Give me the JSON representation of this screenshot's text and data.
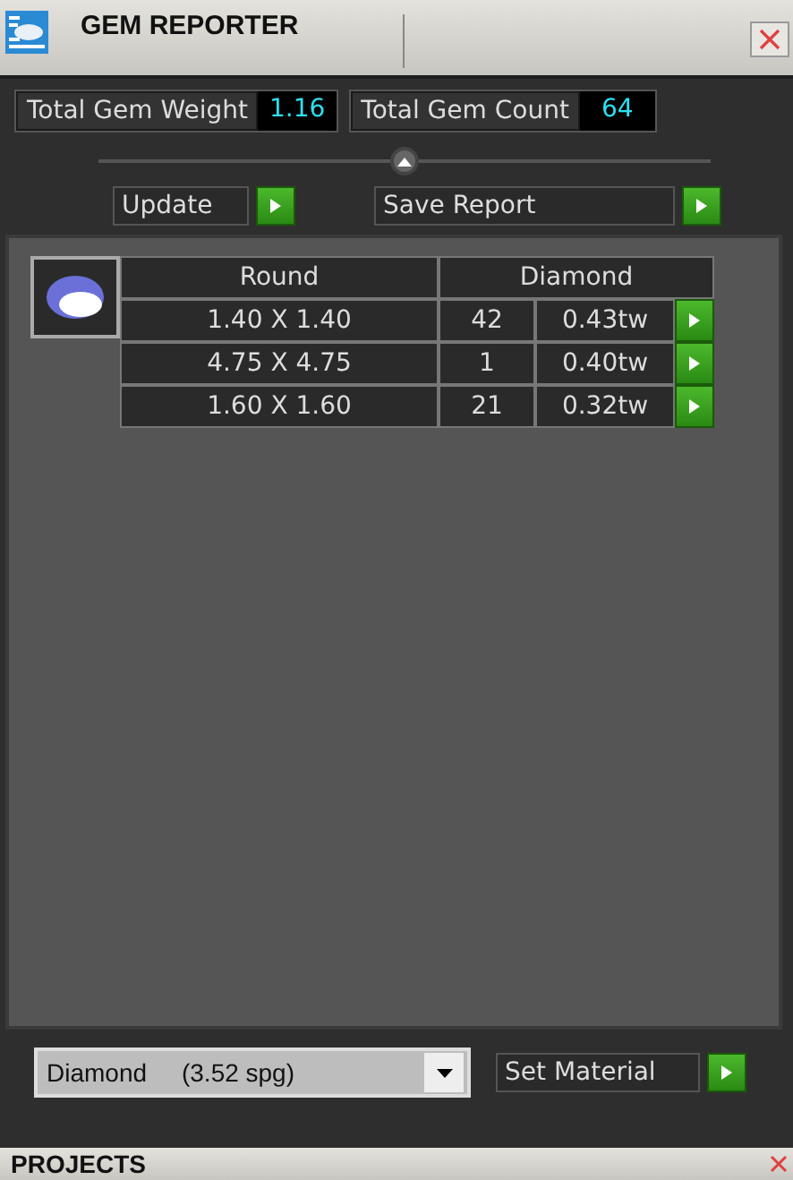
{
  "window": {
    "title": "GEM REPORTER"
  },
  "stats": [
    {
      "label": "Total Gem Weight",
      "value": "1.16"
    },
    {
      "label": "Total Gem Count",
      "value": "64"
    }
  ],
  "actions": [
    {
      "label": "Update"
    },
    {
      "label": "Save Report"
    }
  ],
  "table": {
    "columns": [
      "Round",
      "Diamond"
    ],
    "rows": [
      {
        "size": "1.40 X 1.40",
        "count": "42",
        "weight": "0.43tw"
      },
      {
        "size": "4.75 X 4.75",
        "count": "1",
        "weight": "0.40tw"
      },
      {
        "size": "1.60 X 1.60",
        "count": "21",
        "weight": "0.32tw"
      }
    ]
  },
  "material": {
    "value": "Diamond     (3.52 spg)",
    "button": "Set Material"
  },
  "next_panel": {
    "title": "PROJECTS"
  }
}
